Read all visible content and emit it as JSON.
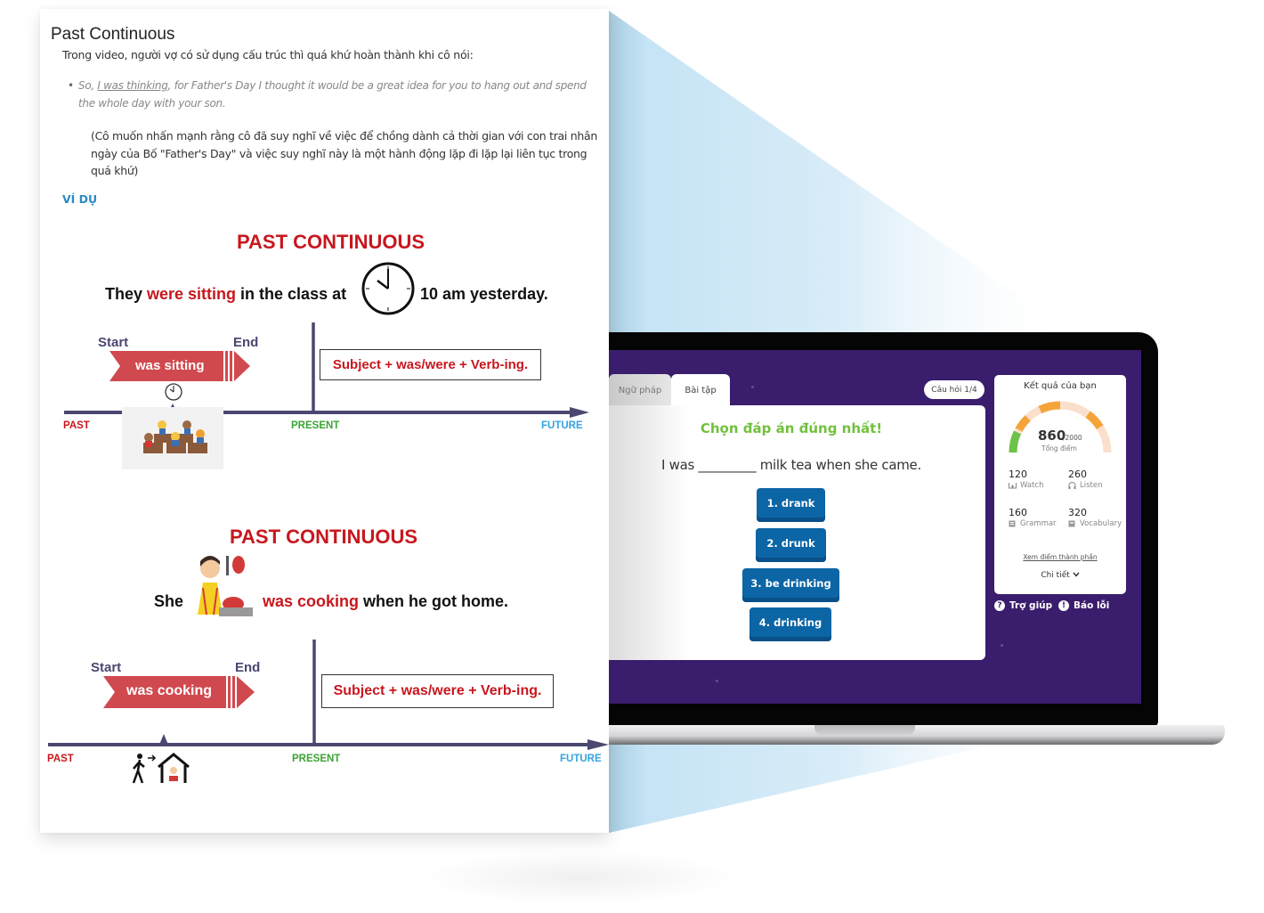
{
  "document": {
    "title": "Past Continuous",
    "intro": "Trong video, người vợ có sử dụng cấu trúc thì quá khứ hoàn thành khi cô nói:",
    "quote_prefix": "So, ",
    "quote_highlight": "I was thinking",
    "quote_rest": ", for Father's Day I thought it would be a great idea for you to hang out and spend the whole day with your son.",
    "explanation": "(Cô muốn nhấn mạnh rằng cô đã suy nghĩ về việc để chồng dành cả thời gian với con trai nhân ngày của Bố \"Father's Day\" và việc suy nghĩ này là một hành động lặp đi lặp lại liên tục trong quá khứ)",
    "example_heading": "VÍ DỤ"
  },
  "diagrams": [
    {
      "title": "PAST CONTINUOUS",
      "sentence_before": "They ",
      "sentence_verb": "were sitting",
      "sentence_middle": " in the class at",
      "sentence_after": "10 am yesterday.",
      "start_label": "Start",
      "end_label": "End",
      "arrow_text": "was sitting",
      "formula": "Subject + was/were + Verb-ing.",
      "past_label": "PAST",
      "present_label": "PRESENT",
      "future_label": "FUTURE",
      "image": "students-in-classroom"
    },
    {
      "title": "PAST CONTINUOUS",
      "sentence_before": "She",
      "sentence_verb": "was cooking",
      "sentence_after": " when he got home.",
      "start_label": "Start",
      "end_label": "End",
      "arrow_text": "was cooking",
      "formula": "Subject + was/were + Verb-ing.",
      "past_label": "PAST",
      "present_label": "PRESENT",
      "future_label": "FUTURE",
      "image": "woman-cooking"
    }
  ],
  "colors": {
    "red": "#c8171e",
    "present_green": "#3aa435",
    "future_blue": "#33a3e0",
    "timeline": "#4a4770",
    "screen_purple": "#3a1d6c",
    "button_blue": "#0c65a5",
    "heading_green": "#71c13c"
  },
  "app": {
    "tabs": [
      {
        "label": "Ngữ pháp",
        "active": false
      },
      {
        "label": "Bài tập",
        "active": true
      }
    ],
    "question_counter": "Câu hỏi 1/4",
    "quiz": {
      "heading": "Chọn đáp án đúng nhất!",
      "sentence": "I was _________ milk tea when she came.",
      "options": [
        "1. drank",
        "2. drunk",
        "3. be drinking",
        "4. drinking"
      ]
    },
    "score": {
      "title": "Kết quả của bạn",
      "total": "860",
      "max": "/2000",
      "total_label": "Tổng điểm",
      "progress_fraction": 0.43,
      "stats": [
        {
          "value": "120",
          "label": "Watch",
          "icon": "glasses-icon"
        },
        {
          "value": "260",
          "label": "Listen",
          "icon": "headphones-icon"
        },
        {
          "value": "160",
          "label": "Grammar",
          "icon": "grammar-book-icon"
        },
        {
          "value": "320",
          "label": "Vocabulary",
          "icon": "vocabulary-book-icon"
        }
      ],
      "link": "Xem điểm thành phần",
      "detail": "Chi tiết"
    },
    "help": "Trợ giúp",
    "report": "Báo lỗi"
  }
}
